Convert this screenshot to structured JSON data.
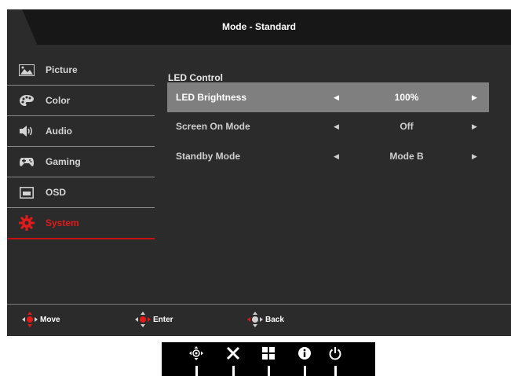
{
  "header": {
    "title": "Mode - Standard"
  },
  "sidebar": {
    "items": [
      {
        "label": "Picture",
        "icon": "picture-icon"
      },
      {
        "label": "Color",
        "icon": "palette-icon"
      },
      {
        "label": "Audio",
        "icon": "speaker-icon"
      },
      {
        "label": "Gaming",
        "icon": "gamepad-icon"
      },
      {
        "label": "OSD",
        "icon": "osd-icon"
      },
      {
        "label": "System",
        "icon": "gear-icon",
        "active": true
      }
    ]
  },
  "main": {
    "section_title": "LED Control",
    "rows": [
      {
        "label": "LED Brightness",
        "value": "100%",
        "selected": true
      },
      {
        "label": "Screen On Mode",
        "value": "Off"
      },
      {
        "label": "Standby Mode",
        "value": "Mode B"
      }
    ],
    "left_arrow": "◀",
    "right_arrow": "▶"
  },
  "footer": {
    "move": "Move",
    "enter": "Enter",
    "back": "Back"
  },
  "colors": {
    "accent": "#e01b1b",
    "panel": "#2b2b2b",
    "header": "#171717",
    "selected_row": "#7f7f7f"
  },
  "hardware_keys": [
    "joystick-icon",
    "close-icon",
    "mode-icon",
    "info-icon",
    "power-icon"
  ]
}
